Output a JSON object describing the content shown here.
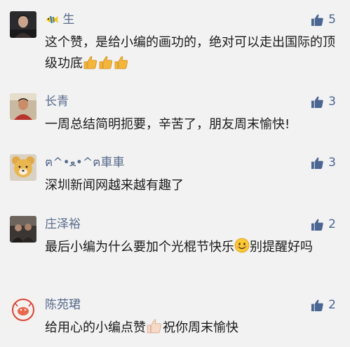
{
  "colors": {
    "name": "#586b8c",
    "like": "#4a6592",
    "background": "#f2f2f2"
  },
  "comments": [
    {
      "name_emoji_icon": "tropical-fish-icon",
      "name": "生",
      "likes": "5",
      "text_before_icons": "这个赞，是给小编的画功的，绝对可以走出国际的顶级功底",
      "trailing_icons": [
        "thumbs-up-emoji-icon",
        "thumbs-up-emoji-icon",
        "thumbs-up-emoji-icon"
      ]
    },
    {
      "name": "长青",
      "likes": "3",
      "text": "一周总结简明扼要，辛苦了，朋友周末愉快!"
    },
    {
      "name": "ฅ^•ﻌ•^ฅ車車",
      "likes": "3",
      "text": "深圳新闻网越来越有趣了"
    },
    {
      "name": "庄泽裕",
      "likes": "2",
      "text_before_icon": "最后小编为什么要加个光棍节快乐",
      "inline_icon": "smiling-face-emoji-icon",
      "text_after_icon": "别提醒好吗"
    },
    {
      "name": "陈苑珺",
      "likes": "2",
      "text_before_icon": "给用心的小编点赞",
      "inline_icon": "thumbs-up-emoji-icon",
      "text_after_icon": "祝你周末愉快"
    }
  ]
}
